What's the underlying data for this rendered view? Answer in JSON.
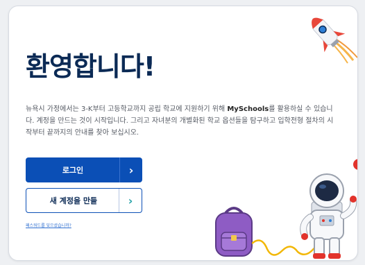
{
  "welcome": {
    "title": "환영합니다!",
    "description_part1": "뉴욕시 가정에서는 3-K부터 고등학교까지 공립 학교에 지원하기 위해 ",
    "description_brand": "MySchools",
    "description_part2": "를 활용하실 수 있습니다. 계정을 만드는 것이 시작입니다. 그리고 자녀분의 개별화된 학교 옵션들을 탐구하고 입학전형 절차의 시작부터 끝까지의 안내를 찾아 보십시오."
  },
  "buttons": {
    "login_label": "로그인",
    "create_account_label": "새 계정을 만들",
    "arrow_glyph": "›"
  },
  "links": {
    "forgot_password": "패스워드를 잊으셨습니까?"
  },
  "illustrations": [
    "rocket",
    "backpack",
    "astronaut",
    "apple"
  ],
  "colors": {
    "title": "#0b2a55",
    "primary": "#0b4fb6",
    "accent_arrow": "#26a2a8",
    "link": "#2f6fd0"
  }
}
